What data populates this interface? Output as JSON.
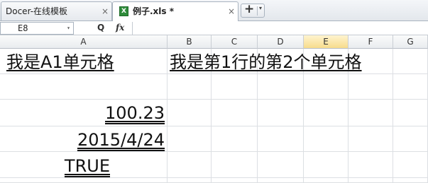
{
  "tabs": [
    {
      "label": "Docer-在线模板",
      "close": "×"
    },
    {
      "label": "例子.xls *",
      "icon": "excel-file-icon",
      "close": "×"
    }
  ],
  "new_tab": {
    "plus": "+",
    "arrow": "▾"
  },
  "formula_bar": {
    "name_box": "E8",
    "dropdown": "▾",
    "zoom": "Q",
    "fx": "fx",
    "formula": ""
  },
  "columns": [
    "A",
    "B",
    "C",
    "D",
    "E",
    "F",
    "G"
  ],
  "selected_column": "E",
  "cells": {
    "a1": "我是A1单元格",
    "b1": "我是第1行的第2个单元格",
    "a3": "100.23",
    "a4": "2015/4/24",
    "a5": "TRUE"
  },
  "colors": {
    "excel_green": "#2e8b3a",
    "selection_header": "#f7dc8c"
  }
}
